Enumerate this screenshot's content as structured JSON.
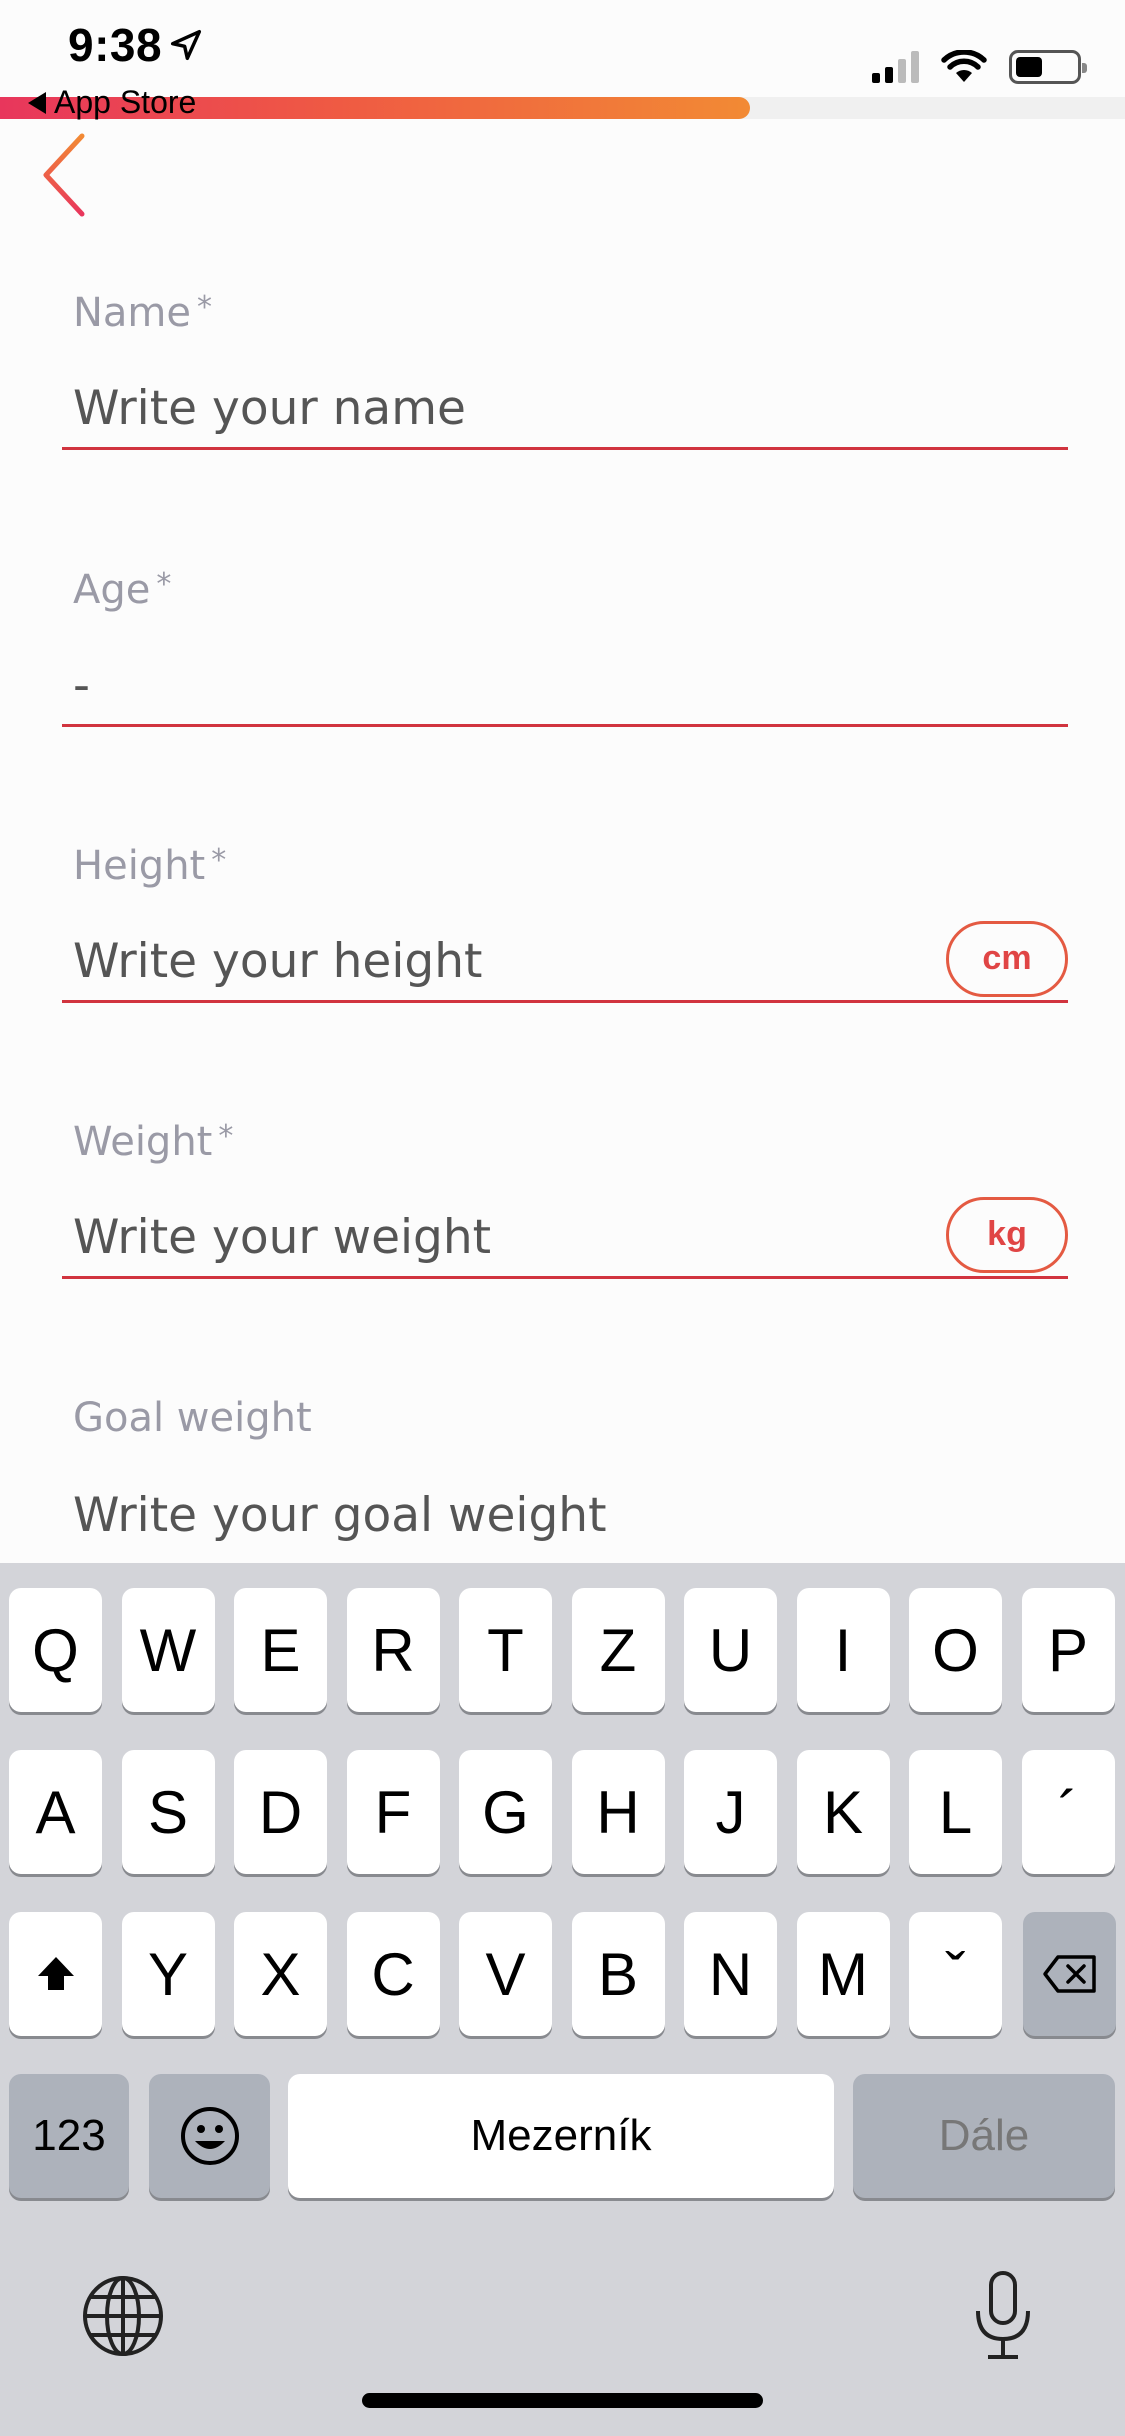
{
  "status_bar": {
    "time": "9:38",
    "back_app_label": "App Store",
    "signal_bars": 2,
    "battery_level": 0.45
  },
  "progress": {
    "fraction": 0.667,
    "gradient": [
      "#e8365c",
      "#ef5a43",
      "#f28a34"
    ]
  },
  "colors": {
    "underline": "#d1343f",
    "label": "#9a9aa6",
    "text": "#555555",
    "unit": "#e04545"
  },
  "form": {
    "name": {
      "label": "Name",
      "required": "*",
      "placeholder": "Write your name"
    },
    "age": {
      "label": "Age",
      "required": "*",
      "value": "-"
    },
    "height": {
      "label": "Height",
      "required": "*",
      "placeholder": "Write your height",
      "unit": "cm"
    },
    "weight": {
      "label": "Weight",
      "required": "*",
      "placeholder": "Write your weight",
      "unit": "kg"
    },
    "goal_weight": {
      "label": "Goal weight",
      "placeholder": "Write your goal weight"
    }
  },
  "keyboard": {
    "row1": [
      "Q",
      "W",
      "E",
      "R",
      "T",
      "Z",
      "U",
      "I",
      "O",
      "P"
    ],
    "row2": [
      "A",
      "S",
      "D",
      "F",
      "G",
      "H",
      "J",
      "K",
      "L",
      "´"
    ],
    "row3": [
      "Y",
      "X",
      "C",
      "V",
      "B",
      "N",
      "M",
      "ˇ"
    ],
    "numbers_key": "123",
    "space_key": "Mezerník",
    "return_key": "Dále",
    "icons": {
      "shift": "shift-icon",
      "delete": "backspace-icon",
      "emoji": "emoji-icon",
      "globe": "globe-icon",
      "mic": "microphone-icon"
    }
  }
}
